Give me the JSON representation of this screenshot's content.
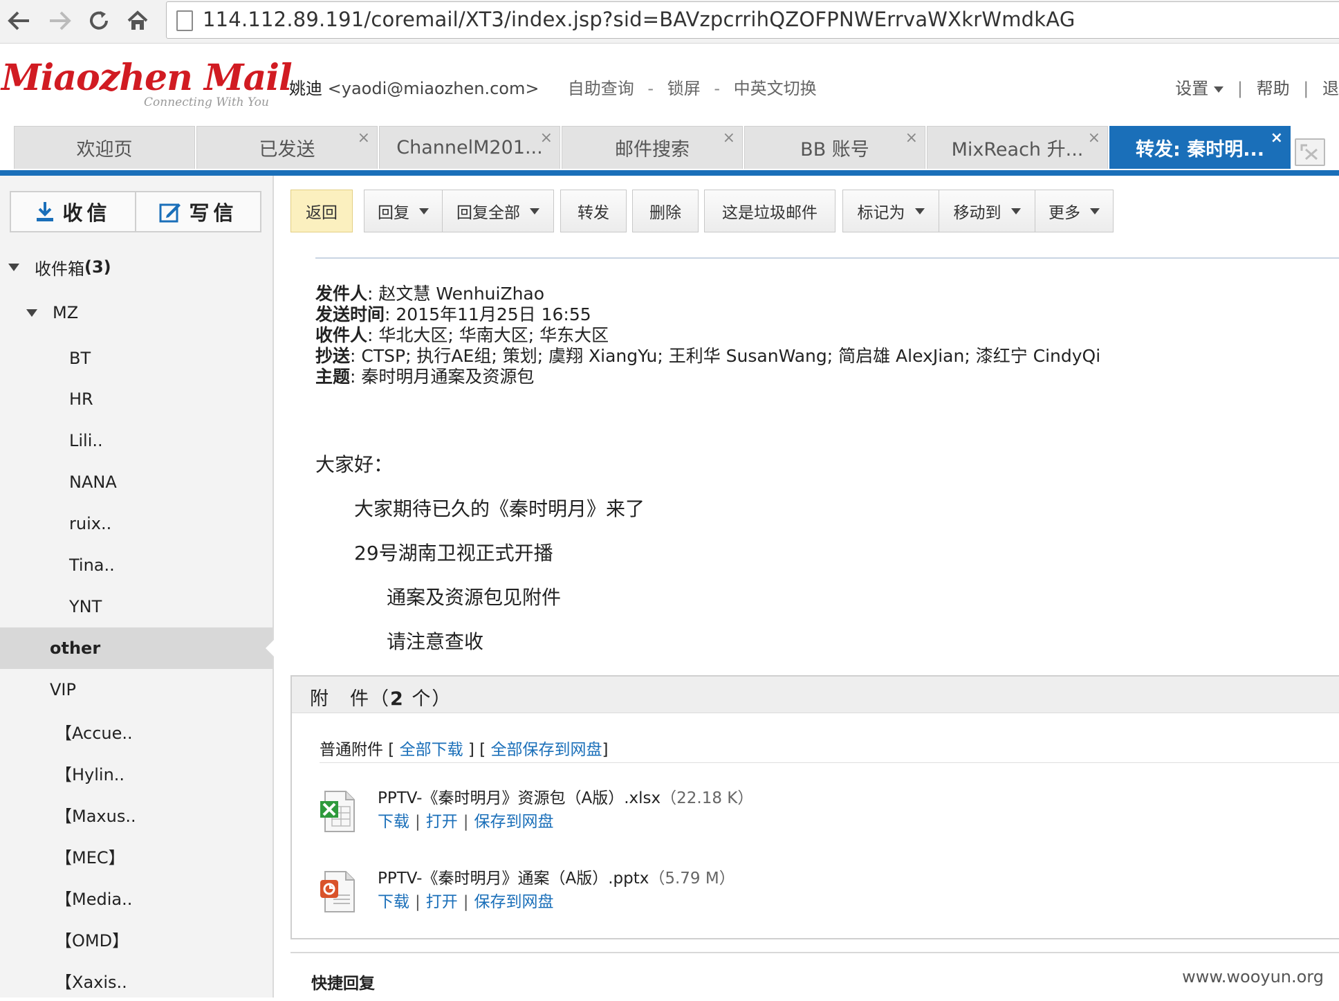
{
  "browser": {
    "url": "114.112.89.191/coremail/XT3/index.jsp?sid=BAVzpcrrihQZOFPNWErrvaWXkrWmdkAG"
  },
  "header": {
    "logo_main": "Miaozhen Mail",
    "logo_sub": "Connecting With You",
    "user_name": "姚迪",
    "user_email": "<yaodi@miaozhen.com>",
    "links": [
      "自助查询",
      "锁屏",
      "中英文切换"
    ],
    "link_sep": "-",
    "right_settings": "设置",
    "right_help": "帮助",
    "right_exit": "退",
    "right_sep": "|"
  },
  "tabs": [
    {
      "label": "欢迎页",
      "closable": false
    },
    {
      "label": "已发送",
      "closable": true
    },
    {
      "label": "ChannelM201...",
      "closable": true
    },
    {
      "label": "邮件搜索",
      "closable": true
    },
    {
      "label": "BB 账号",
      "closable": true
    },
    {
      "label": "MixReach 升...",
      "closable": true
    },
    {
      "label": "转发: 秦时明...",
      "closable": true,
      "active": true
    }
  ],
  "tab_close_glyph": "×",
  "sidebar": {
    "receive_label": "收信",
    "compose_label": "写信",
    "inbox_label": "收件箱",
    "inbox_count": "(3)",
    "folders": [
      {
        "label": "MZ"
      },
      {
        "label": "BT"
      },
      {
        "label": "HR"
      },
      {
        "label": "Lili.."
      },
      {
        "label": "NANA"
      },
      {
        "label": "ruix.."
      },
      {
        "label": "Tina.."
      },
      {
        "label": "YNT"
      },
      {
        "label": "other"
      },
      {
        "label": "VIP"
      },
      {
        "label": "【Accue.."
      },
      {
        "label": "【Hylin.."
      },
      {
        "label": "【Maxus.."
      },
      {
        "label": "【MEC】"
      },
      {
        "label": "【Media.."
      },
      {
        "label": "【OMD】"
      },
      {
        "label": "【Xaxis.."
      }
    ]
  },
  "toolbar": {
    "back": "返回",
    "reply": "回复",
    "reply_all": "回复全部",
    "forward": "转发",
    "delete": "删除",
    "spam": "这是垃圾邮件",
    "mark_as": "标记为",
    "move_to": "移动到",
    "more": "更多"
  },
  "message": {
    "from_label": "发件人",
    "from": "赵文慧 WenhuiZhao",
    "sent_label": "发送时间",
    "sent": "2015年11月25日 16:55",
    "to_label": "收件人",
    "to": "华北大区; 华南大区; 华东大区",
    "cc_label": "抄送",
    "cc": "CTSP; 执行AE组; 策划; 虞翔 XiangYu; 王利华 SusanWang; 简启雄 AlexJian; 漆红宁 CindyQi",
    "subject_label": "主题",
    "subject": "秦时明月通案及资源包",
    "body": [
      "大家好：",
      "大家期待已久的《秦时明月》来了",
      "29号湖南卫视正式开播",
      "通案及资源包见附件",
      "请注意查收"
    ]
  },
  "attachments": {
    "header_label": "附　件（",
    "header_count": "2",
    "header_suffix": " 个）",
    "normal_label": "普通附件",
    "download_all": "全部下载",
    "save_all": "全部保存到网盘",
    "files": [
      {
        "name": "PPTV-《秦时明月》资源包（A版）.xlsx",
        "size": "（22.18 K）",
        "icon": "excel-file-icon"
      },
      {
        "name": "PPTV-《秦时明月》通案（A版）.pptx",
        "size": "（5.79 M）",
        "icon": "powerpoint-file-icon"
      }
    ],
    "action_download": "下载",
    "action_open": "打开",
    "action_save": "保存到网盘"
  },
  "quick_reply": "快捷回复",
  "watermark": "www.wooyun.org",
  "colors": {
    "brand_red": "#d11b22",
    "tab_active": "#1a6fb9",
    "link_blue": "#1a6fb9",
    "back_button": "#fbf0bf"
  }
}
